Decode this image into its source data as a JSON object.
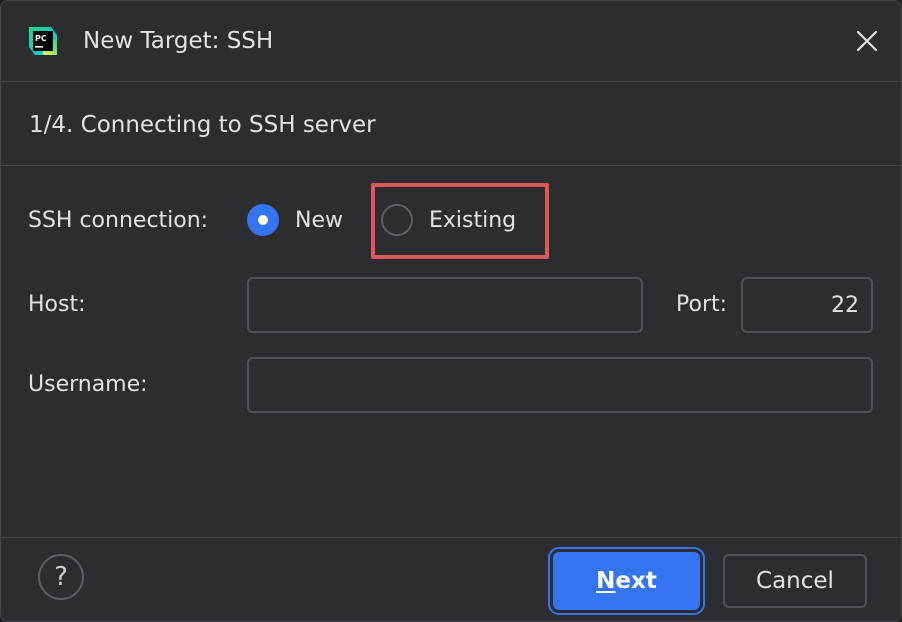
{
  "window": {
    "title": "New Target: SSH",
    "app_icon_text": "PC",
    "close_icon": "close-icon"
  },
  "step": {
    "title": "1/4. Connecting to SSH server"
  },
  "ssh_connection": {
    "label": "SSH connection:",
    "options": [
      {
        "label": "New",
        "selected": true
      },
      {
        "label": "Existing",
        "selected": false
      }
    ]
  },
  "host": {
    "label": "Host:",
    "value": "",
    "placeholder": ""
  },
  "port": {
    "label": "Port:",
    "value": "22"
  },
  "username": {
    "label": "Username:",
    "value": "",
    "placeholder": ""
  },
  "footer": {
    "help_label": "?",
    "next_mnemonic": "N",
    "next_rest": "ext",
    "cancel_label": "Cancel"
  },
  "colors": {
    "accent": "#3574f0",
    "highlight": "#e4545a",
    "background": "#2b2d30"
  }
}
